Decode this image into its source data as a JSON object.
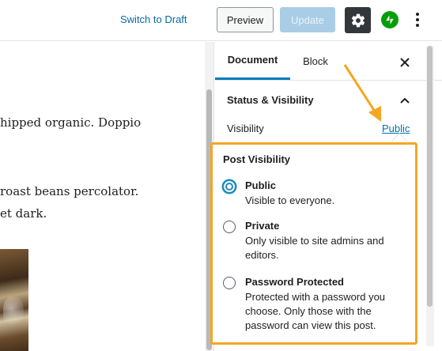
{
  "topbar": {
    "switch_to_draft": "Switch to Draft",
    "preview_label": "Preview",
    "update_label": "Update"
  },
  "editor": {
    "lines": [
      "hipped organic. Doppio",
      "roast beans percolator.",
      "et dark."
    ]
  },
  "sidebar": {
    "tabs": [
      "Document",
      "Block"
    ],
    "close_icon": "close-icon",
    "panel_title": "Status & Visibility",
    "visibility_label": "Visibility",
    "visibility_value": "Public"
  },
  "popover": {
    "title": "Post Visibility",
    "options": [
      {
        "label": "Public",
        "description": "Visible to everyone.",
        "selected": true
      },
      {
        "label": "Private",
        "description": "Only visible to site admins and editors.",
        "selected": false
      },
      {
        "label": "Password Protected",
        "description": "Protected with a password you choose. Only those with the password can view this post.",
        "selected": false
      }
    ]
  },
  "colors": {
    "accent": "#007cba",
    "highlight": "#f5a623",
    "jetpack": "#069e08",
    "settings_bg": "#32373c",
    "update_disabled": "#a9cde6"
  }
}
